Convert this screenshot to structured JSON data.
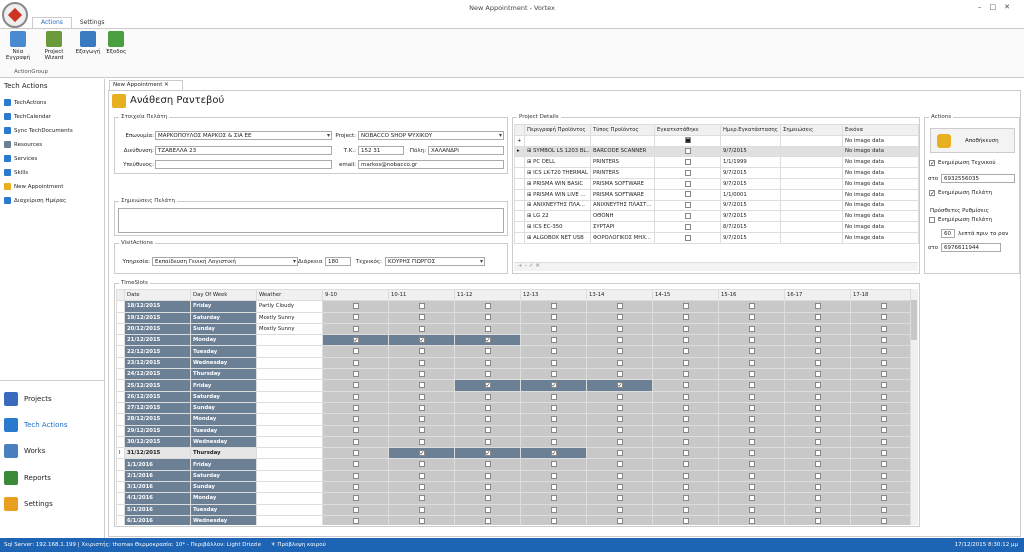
{
  "window": {
    "title": "New Appointment - Vortex"
  },
  "ribbon": {
    "tabs": [
      "Actions",
      "Settings"
    ],
    "buttons": [
      "Νέα Εγγραφή",
      "Project Wizard",
      "Εξαγωγή",
      "Έξοδος"
    ],
    "group": "ActionGroup"
  },
  "sidebar": {
    "title": "Tech Actions",
    "items": [
      "TechActions",
      "TechCalendar",
      "Sync TechDocuments",
      "Resources",
      "Services",
      "Skills",
      "New Appointment",
      "Διαχείριση Ημέρας"
    ],
    "nav": [
      "Projects",
      "Tech Actions",
      "Works",
      "Reports",
      "Settings"
    ]
  },
  "doc": {
    "tab": "New Appointment",
    "heading": "Ανάθεση Ραντεβού"
  },
  "customer": {
    "legend": "Στοιχεία Πελάτη",
    "name_label": "Επωνυμία:",
    "name": "ΜΑΡΚΟΠΟΥΛΟΣ ΜΑΡΚΟΣ & ΣΙΑ ΕΕ",
    "project_label": "Project:",
    "project": "ΝΟΒΑCCO SHOP ΨΥΧΙΚΟΥ",
    "address_label": "Διεύθυνση:",
    "address": "ΤΖΑΒΕΛΛΑ 23",
    "tk_label": "Τ.Κ.:",
    "tk": "152 31",
    "city_label": "Πόλη:",
    "city": "ΧΑΛΑΝΔΡΙ",
    "resp_label": "Υπεύθυνος:",
    "resp": "",
    "email_label": "email:",
    "email": "markos@nobacco.gr"
  },
  "notes": {
    "legend": "Σημειώσεις Πελάτη"
  },
  "visit": {
    "legend": "VisitActions",
    "service_label": "Υπηρεσία:",
    "service": "Εκπαίδευση Γενική Λογιστική",
    "duration_label": "Διάρκεια",
    "duration": "180",
    "tech_label": "Τεχνικός:",
    "tech": "ΚΟΥΡΗΣ ΓΙΩΡΓΟΣ"
  },
  "project_details": {
    "legend": "Project Details",
    "columns": [
      "Περιγραφή Προϊόντος",
      "Τύπος Προϊόντος",
      "Εγκατεστάθηκε",
      "Ημερ.Εγκατάστασης",
      "Σημειώσεις",
      "Εικόνα"
    ],
    "rows": [
      {
        "desc": "SYMBOL LS 1203 BL...",
        "type": "BARCODE SCANNER",
        "date": "9/7/2015",
        "img": "No image data",
        "on": false
      },
      {
        "desc": "PC DELL",
        "type": "PRINTERS",
        "date": "1/1/1999",
        "img": "No image data",
        "on": false
      },
      {
        "desc": "ICS LK-T20 THERMAL",
        "type": "PRINTERS",
        "date": "9/7/2015",
        "img": "No image data",
        "on": false
      },
      {
        "desc": "PRISMA WIN BASIC",
        "type": "PRISMA SOFTWARE",
        "date": "9/7/2015",
        "img": "No image data",
        "on": false
      },
      {
        "desc": "PRISMA WIN LIVE ...",
        "type": "PRISMA SOFTWARE",
        "date": "1/1/0001",
        "img": "No image data",
        "on": false
      },
      {
        "desc": "ΑΝΙΧΝΕΥΤΗΣ ΠΛΑ...",
        "type": "ΑΝΙΧΝΕΥΤΗΣ ΠΛΑΣΤ...",
        "date": "9/7/2015",
        "img": "No image data",
        "on": false
      },
      {
        "desc": "LG 22",
        "type": "ΟΘΟΝΗ",
        "date": "9/7/2015",
        "img": "No image data",
        "on": false
      },
      {
        "desc": "ICS EC-350",
        "type": "ΣΥΡΤΑΡΙ",
        "date": "8/7/2015",
        "img": "No image data",
        "on": false
      },
      {
        "desc": "ALGOBOX NET USB",
        "type": "ΦΟΡΟΛΟΓΙΚΟΣ ΜΗΧ...",
        "date": "9/7/2015",
        "img": "No image data",
        "on": false
      }
    ],
    "newrow_img": "No image data"
  },
  "actions": {
    "legend": "Actions",
    "assign": "Αποθήκευση",
    "notify_tech": "Ενημέρωση Τεχνικού",
    "sto1": "στο",
    "phone1": "6932556035",
    "notify_client": "Ενημέρωση Πελάτη",
    "extra": "Πρόσθετες Ρυθμίσεις",
    "notify_client2": "Ενημέρωση Πελάτη",
    "minutes": "60",
    "minutes_label": "λεπτά πριν το ραν",
    "sto2": "στο",
    "phone2": "6976611944"
  },
  "timeslots": {
    "legend": "TimeSlots",
    "columns": [
      "Date",
      "Day Of Week",
      "Weather",
      "9-10",
      "10-11",
      "11-12",
      "12-13",
      "13-14",
      "14-15",
      "15-16",
      "16-17",
      "17-18"
    ],
    "rows": [
      {
        "date": "18/12/2015",
        "day": "Friday",
        "weather": "Partly Cloudy",
        "hi": [],
        "chk": []
      },
      {
        "date": "19/12/2015",
        "day": "Saturday",
        "weather": "Mostly Sunny",
        "hi": [],
        "chk": []
      },
      {
        "date": "20/12/2015",
        "day": "Sunday",
        "weather": "Mostly Sunny",
        "hi": [],
        "chk": []
      },
      {
        "date": "21/12/2015",
        "day": "Monday",
        "weather": "",
        "hi": [
          0,
          1,
          2
        ],
        "chk": [
          0,
          1,
          2
        ]
      },
      {
        "date": "22/12/2015",
        "day": "Tuesday",
        "weather": "",
        "hi": [],
        "chk": []
      },
      {
        "date": "23/12/2015",
        "day": "Wednesday",
        "weather": "",
        "hi": [],
        "chk": []
      },
      {
        "date": "24/12/2015",
        "day": "Thursday",
        "weather": "",
        "hi": [],
        "chk": []
      },
      {
        "date": "25/12/2015",
        "day": "Friday",
        "weather": "",
        "hi": [
          2,
          3,
          4
        ],
        "chk": [
          2,
          3,
          4
        ]
      },
      {
        "date": "26/12/2015",
        "day": "Saturday",
        "weather": "",
        "hi": [],
        "chk": []
      },
      {
        "date": "27/12/2015",
        "day": "Sunday",
        "weather": "",
        "hi": [],
        "chk": []
      },
      {
        "date": "28/12/2015",
        "day": "Monday",
        "weather": "",
        "hi": [],
        "chk": []
      },
      {
        "date": "29/12/2015",
        "day": "Tuesday",
        "weather": "",
        "hi": [],
        "chk": []
      },
      {
        "date": "30/12/2015",
        "day": "Wednesday",
        "weather": "",
        "hi": [],
        "chk": []
      },
      {
        "date": "31/12/2015",
        "day": "Thursday",
        "weather": "",
        "hi": [
          1,
          2,
          3
        ],
        "chk": [
          1,
          2,
          3
        ],
        "sel": true
      },
      {
        "date": "1/1/2016",
        "day": "Friday",
        "weather": "",
        "hi": [],
        "chk": []
      },
      {
        "date": "2/1/2016",
        "day": "Saturday",
        "weather": "",
        "hi": [],
        "chk": []
      },
      {
        "date": "3/1/2016",
        "day": "Sunday",
        "weather": "",
        "hi": [],
        "chk": []
      },
      {
        "date": "4/1/2016",
        "day": "Monday",
        "weather": "",
        "hi": [],
        "chk": []
      },
      {
        "date": "5/1/2016",
        "day": "Tuesday",
        "weather": "",
        "hi": [],
        "chk": []
      },
      {
        "date": "6/1/2016",
        "day": "Wednesday",
        "weather": "",
        "hi": [],
        "chk": []
      }
    ]
  },
  "status": {
    "left": "Sql Server: 192.168.1.199 | Χειριστής: thomas   Θερμοκρασία: 10* - Περιβάλλον: Light Drizzle",
    "weather_link": "Πρόβλεψη καιρού",
    "right": "17/12/2015 8:30:12 μμ"
  }
}
